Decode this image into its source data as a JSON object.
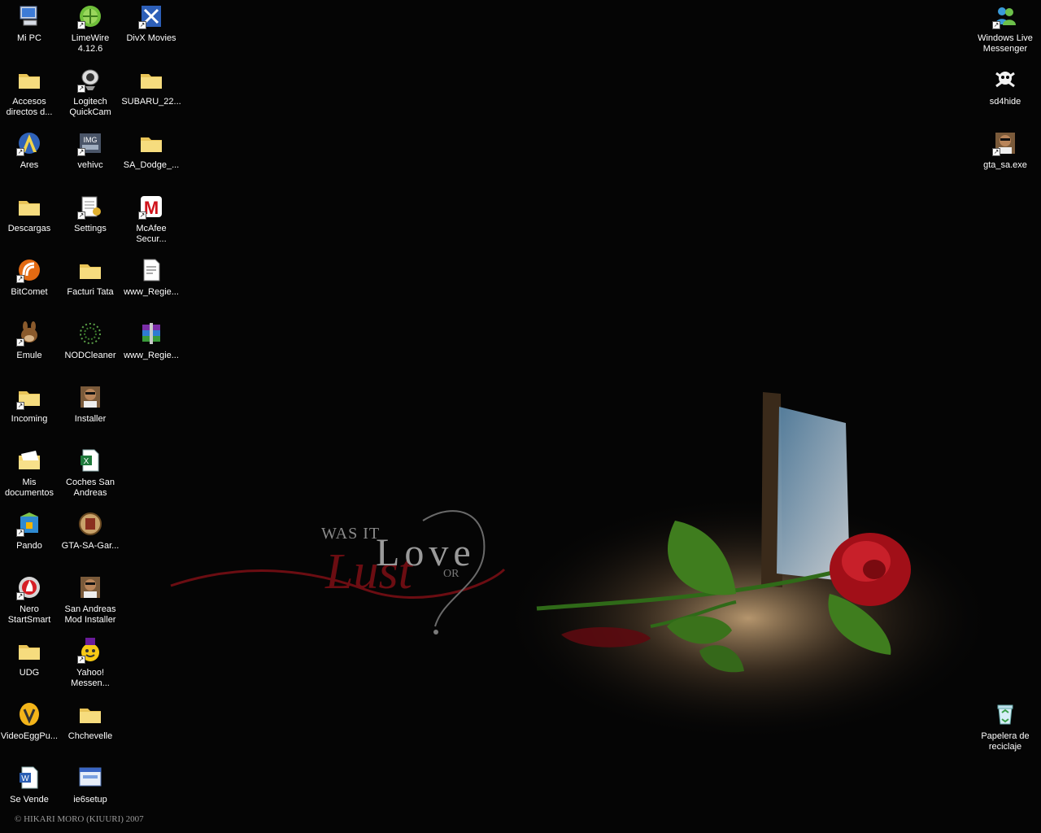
{
  "wallpaper": {
    "tagline_top": "WAS IT",
    "word_love": "Love",
    "word_or": "OR",
    "word_lust": "Lust",
    "credit": "© HIKARI MORO (KIUURI) 2007"
  },
  "colors": {
    "desktop_bg": "#050505",
    "folder": "#f3d36b",
    "rose": "#b3121b",
    "leaf": "#3f7d1e",
    "label_text": "#ffffff"
  },
  "icons": [
    {
      "label": "Mi PC",
      "icon": "my-computer-icon",
      "shortcut": false
    },
    {
      "label": "Accesos\ndirectos d...",
      "icon": "folder-icon",
      "shortcut": false
    },
    {
      "label": "Ares",
      "icon": "ares-icon",
      "shortcut": true
    },
    {
      "label": "Descargas",
      "icon": "folder-icon",
      "shortcut": false
    },
    {
      "label": "BitComet",
      "icon": "bitcomet-icon",
      "shortcut": true
    },
    {
      "label": "Emule",
      "icon": "emule-icon",
      "shortcut": true
    },
    {
      "label": "Incoming",
      "icon": "folder-icon",
      "shortcut": true
    },
    {
      "label": "Mis\ndocumentos",
      "icon": "my-documents-icon",
      "shortcut": false
    },
    {
      "label": "Pando",
      "icon": "pando-icon",
      "shortcut": true
    },
    {
      "label": "Nero\nStartSmart",
      "icon": "nero-icon",
      "shortcut": true
    },
    {
      "label": "UDG",
      "icon": "folder-icon",
      "shortcut": false
    },
    {
      "label": "VideoEggPu...",
      "icon": "videoegg-icon",
      "shortcut": false
    },
    {
      "label": "Se Vende",
      "icon": "word-document-icon",
      "shortcut": false
    },
    {
      "label": "LimeWire\n4.12.6",
      "icon": "limewire-icon",
      "shortcut": true
    },
    {
      "label": "Logitech\nQuickCam",
      "icon": "webcam-icon",
      "shortcut": true
    },
    {
      "label": "vehivc",
      "icon": "img-tool-icon",
      "shortcut": true
    },
    {
      "label": "Settings",
      "icon": "settings-notepad-icon",
      "shortcut": true
    },
    {
      "label": "Facturi Tata",
      "icon": "folder-icon",
      "shortcut": false
    },
    {
      "label": "NODCleaner",
      "icon": "nodcleaner-icon",
      "shortcut": false
    },
    {
      "label": "Installer",
      "icon": "gta-character-icon",
      "shortcut": false
    },
    {
      "label": "Coches San\nAndreas",
      "icon": "excel-document-icon",
      "shortcut": false
    },
    {
      "label": "GTA-SA-Gar...",
      "icon": "gta-garage-icon",
      "shortcut": false
    },
    {
      "label": "San Andreas\nMod Installer",
      "icon": "gta-character-icon",
      "shortcut": false
    },
    {
      "label": "Yahoo!\nMessen...",
      "icon": "yahoo-messenger-icon",
      "shortcut": true
    },
    {
      "label": "Chchevelle",
      "icon": "folder-icon",
      "shortcut": false
    },
    {
      "label": "ie6setup",
      "icon": "installer-window-icon",
      "shortcut": false
    },
    {
      "label": "DivX Movies",
      "icon": "divx-icon",
      "shortcut": true
    },
    {
      "label": "SUBARU_22...",
      "icon": "folder-icon",
      "shortcut": false
    },
    {
      "label": "SA_Dodge_...",
      "icon": "folder-icon",
      "shortcut": false
    },
    {
      "label": "McAfee\nSecur...",
      "icon": "mcafee-icon",
      "shortcut": true
    },
    {
      "label": "www_Regie...",
      "icon": "text-document-icon",
      "shortcut": false
    },
    {
      "label": "www_Regie...",
      "icon": "winrar-archive-icon",
      "shortcut": false
    },
    {
      "label": "Windows Live\nMessenger",
      "icon": "windows-live-messenger-icon",
      "shortcut": true
    },
    {
      "label": "sd4hide",
      "icon": "skull-crossbones-icon",
      "shortcut": false
    },
    {
      "label": "gta_sa.exe",
      "icon": "gta-character-icon",
      "shortcut": true
    },
    {
      "label": "Papelera de\nreciclaje",
      "icon": "recycle-bin-icon",
      "shortcut": false
    }
  ]
}
